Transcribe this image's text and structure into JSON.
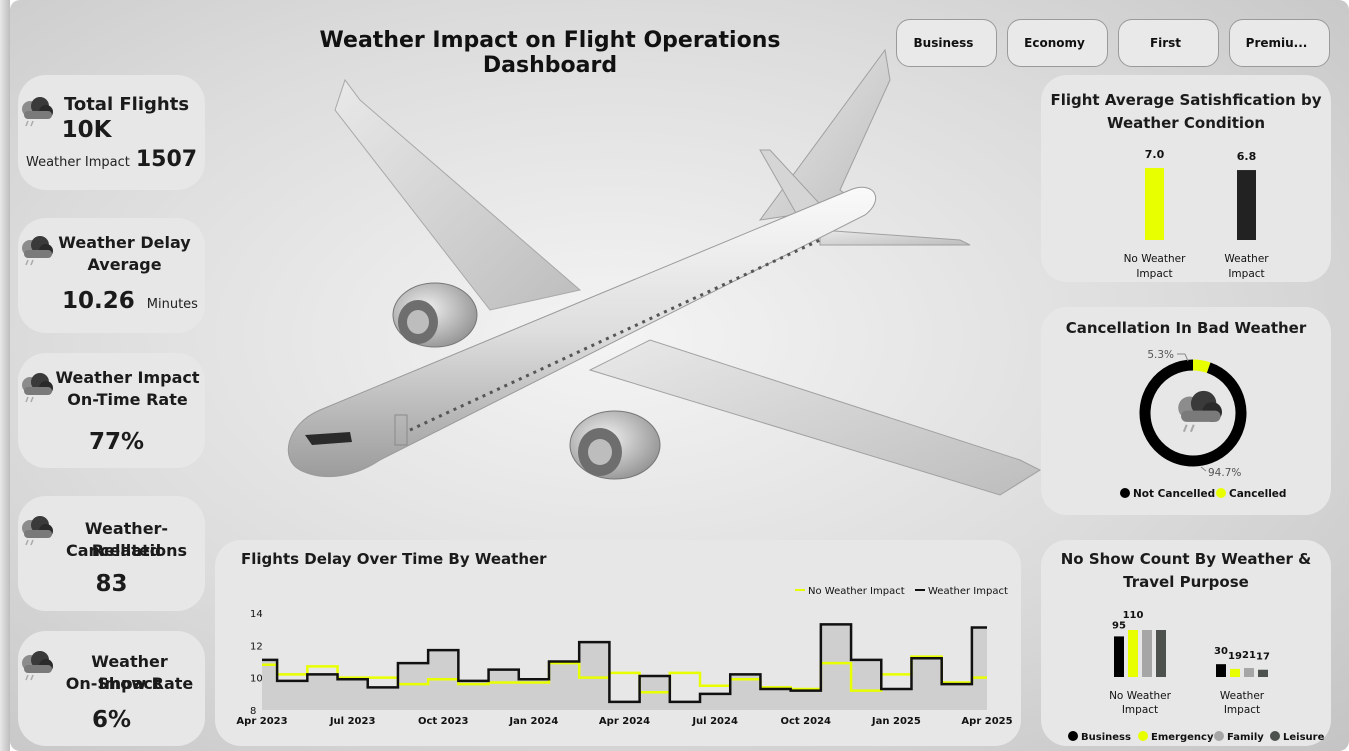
{
  "title": "Weather Impact on Flight Operations Dashboard",
  "slicers": [
    "Business",
    "Economy",
    "First",
    "Premiu..."
  ],
  "kpis": {
    "total_flights": {
      "label": "Total Flights",
      "value": "10K",
      "sub_label": "Weather Impact",
      "sub_value": "1507"
    },
    "delay_avg": {
      "label_line1": "Weather Delay",
      "label_line2": "Average",
      "value": "10.26",
      "unit": "Minutes"
    },
    "ontime": {
      "label_line1": "Weather Impact",
      "label_line2": "On-Time Rate",
      "value": "77%"
    },
    "cancellations": {
      "label_line1": "Weather-Related",
      "label_line2": "Cancellations",
      "value": "83"
    },
    "onshow": {
      "label_line1": "Weather Impact",
      "label_line2": "On-Show Rate",
      "value": "6%"
    }
  },
  "icons": {
    "kpi": "rain-cloud-icon",
    "slicer": "none"
  },
  "colors": {
    "accent": "#e8ff00",
    "dark": "#222222",
    "gray": "#a6a6a6",
    "darkgray": "#4d524f"
  },
  "satisfaction": {
    "title_line1": "Flight Average Satishfication by",
    "title_line2": "Weather Condition",
    "chart_data": {
      "type": "bar",
      "categories": [
        "No Weather Impact",
        "Weather Impact"
      ],
      "category_lines": [
        [
          "No Weather",
          "Impact"
        ],
        [
          "Weather",
          "Impact"
        ]
      ],
      "values": [
        7.0,
        6.8
      ],
      "value_labels": [
        "7.0",
        "6.8"
      ],
      "colors": [
        "#e8ff00",
        "#222222"
      ]
    }
  },
  "cancellation": {
    "title": "Cancellation In Bad Weather",
    "chart_data": {
      "type": "pie",
      "labels": [
        "Not Cancelled",
        "Cancelled"
      ],
      "values": [
        94.7,
        5.3
      ],
      "value_labels": [
        "94.7%",
        "5.3%"
      ],
      "colors": [
        "#000000",
        "#e8ff00"
      ]
    }
  },
  "noshow": {
    "title_line1": "No Show Count By Weather &",
    "title_line2": "Travel Purpose",
    "chart_data": {
      "type": "bar",
      "categories": [
        "No Weather Impact",
        "Weather Impact"
      ],
      "category_lines": [
        [
          "No Weather",
          "Impact"
        ],
        [
          "Weather",
          "Impact"
        ]
      ],
      "series": [
        {
          "name": "Business",
          "values": [
            95,
            30
          ],
          "color": "#000000"
        },
        {
          "name": "Emergency",
          "values": [
            110,
            19
          ],
          "color": "#e8ff00"
        },
        {
          "name": "Family",
          "values": [
            110,
            21
          ],
          "color": "#a6a6a6"
        },
        {
          "name": "Leisure",
          "values": [
            110,
            17
          ],
          "color": "#4d524f"
        }
      ],
      "value_labels": [
        [
          "95",
          "110",
          "",
          ""
        ],
        [
          "30",
          "19",
          "21",
          "17"
        ]
      ],
      "group_labels": [
        "110",
        ""
      ]
    }
  },
  "delay": {
    "title": "Flights Delay Over Time By Weather",
    "chart_data": {
      "type": "line",
      "x": [
        "Apr 2023",
        "May 2023",
        "Jun 2023",
        "Jul 2023",
        "Aug 2023",
        "Sep 2023",
        "Oct 2023",
        "Nov 2023",
        "Dec 2023",
        "Jan 2024",
        "Feb 2024",
        "Mar 2024",
        "Apr 2024",
        "May 2024",
        "Jun 2024",
        "Jul 2024",
        "Aug 2024",
        "Sep 2024",
        "Oct 2024",
        "Nov 2024",
        "Dec 2024",
        "Jan 2025",
        "Feb 2025",
        "Mar 2025",
        "Apr 2025"
      ],
      "xticks": [
        "Apr 2023",
        "Jul 2023",
        "Oct 2023",
        "Jan 2024",
        "Apr 2024",
        "Jul 2024",
        "Oct 2024",
        "Jan 2025",
        "Apr 2025"
      ],
      "yticks": [
        "8",
        "10",
        "12",
        "14"
      ],
      "ylim": [
        8,
        14
      ],
      "series": [
        {
          "name": "No Weather Impact",
          "color": "#e8ff00",
          "values": [
            10.8,
            10.2,
            10.7,
            10.0,
            10.0,
            9.6,
            9.9,
            9.6,
            9.7,
            9.7,
            10.9,
            10.0,
            10.3,
            9.1,
            10.3,
            9.5,
            9.9,
            9.4,
            9.3,
            10.9,
            9.2,
            10.2,
            11.3,
            9.7,
            10.0
          ]
        },
        {
          "name": "Weather Impact",
          "color": "#111111",
          "values": [
            11.1,
            9.8,
            10.2,
            9.9,
            9.4,
            10.9,
            11.7,
            9.8,
            10.5,
            9.9,
            11.0,
            12.2,
            8.5,
            10.1,
            8.5,
            9.0,
            10.2,
            9.3,
            9.2,
            13.3,
            11.1,
            9.3,
            11.2,
            9.6,
            13.1
          ]
        }
      ]
    }
  }
}
